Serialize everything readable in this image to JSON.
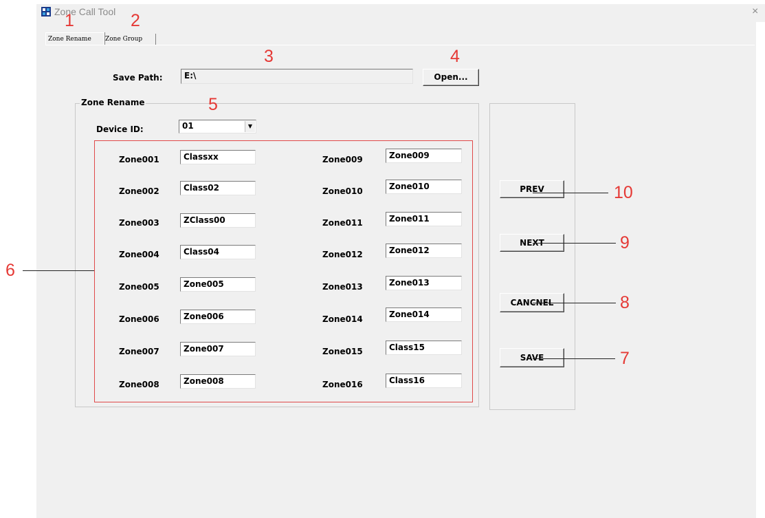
{
  "window": {
    "title": "Zone Call Tool",
    "close": "×"
  },
  "tabs": [
    {
      "label": "Zone Rename",
      "active": true
    },
    {
      "label": "Zone Group",
      "active": false
    }
  ],
  "save_path": {
    "label": "Save Path:",
    "value": "E:\\",
    "open_button": "Open..."
  },
  "zone_rename": {
    "legend": "Zone Rename",
    "device_id_label": "Device ID:",
    "device_id_value": "01",
    "left_zones": [
      {
        "label": "Zone001",
        "value": "Classxx"
      },
      {
        "label": "Zone002",
        "value": "Class02"
      },
      {
        "label": "Zone003",
        "value": "ZClass00"
      },
      {
        "label": "Zone004",
        "value": "Class04"
      },
      {
        "label": "Zone005",
        "value": "Zone005"
      },
      {
        "label": "Zone006",
        "value": "Zone006"
      },
      {
        "label": "Zone007",
        "value": "Zone007"
      },
      {
        "label": "Zone008",
        "value": "Zone008"
      }
    ],
    "right_zones": [
      {
        "label": "Zone009",
        "value": "Zone009"
      },
      {
        "label": "Zone010",
        "value": "Zone010"
      },
      {
        "label": "Zone011",
        "value": "Zone011"
      },
      {
        "label": "Zone012",
        "value": "Zone012"
      },
      {
        "label": "Zone013",
        "value": "Zone013"
      },
      {
        "label": "Zone014",
        "value": "Zone014"
      },
      {
        "label": "Zone015",
        "value": "Class15"
      },
      {
        "label": "Zone016",
        "value": "Class16"
      }
    ]
  },
  "buttons": {
    "prev": "PREV",
    "next": "NEXT",
    "cancel": "CANCNEL",
    "save": "SAVE"
  },
  "annotations": {
    "n1": "1",
    "n2": "2",
    "n3": "3",
    "n4": "4",
    "n5": "5",
    "n6": "6",
    "n7": "7",
    "n8": "8",
    "n9": "9",
    "n10": "10"
  },
  "colors": {
    "annotation": "#e53935",
    "window_bg": "#f0f0f0"
  }
}
